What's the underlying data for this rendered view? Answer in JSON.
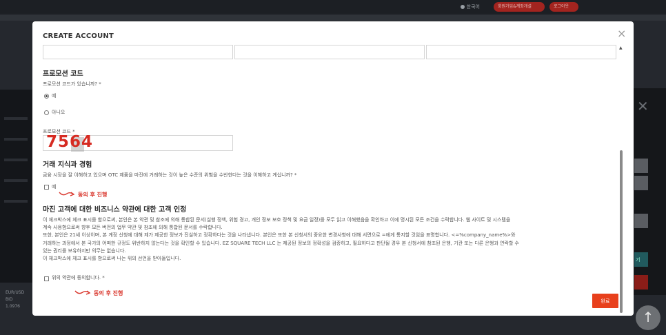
{
  "background": {
    "language": "한국어",
    "signup_button": "회원가입&계좌개설",
    "login_button": "로그아웃",
    "ticker": {
      "pair": "EUR/USD",
      "label": "BID",
      "value": "1.0976"
    },
    "side_button_label": "기"
  },
  "modal": {
    "title": "CREATE ACCOUNT",
    "close_symbol": "×",
    "promo": {
      "heading": "프로모션 코드",
      "question": "프로모션 코드가 있습니까? *",
      "options": [
        {
          "label": "예",
          "selected": true
        },
        {
          "label": "아니오",
          "selected": false
        }
      ],
      "field_label": "프로모션 코드 *",
      "field_value": "7564"
    },
    "knowledge": {
      "heading": "거래 지식과 경험",
      "question": "금융 시장을 잘 이해하고 있으며 OTC 제품을 마진에 거래하는 것이 높은 수준의 위험을 수반한다는 것을 이해하고 계십니까? *",
      "checkbox_label": "예",
      "annotation": "동의 후 진행"
    },
    "terms": {
      "heading": "마진 고객에 대한 비즈니스 약관에 대한 고객 인정",
      "paragraph1_line1": "이 체크박스에 체크 표시를 함으로써, 본인은 본 약관 및 참조에 의해 통합된 문서(실행 정책, 위험 경고, 개인 정보 보호 정책 및 요금 일정)를 모두 읽고 이해했음을 확인하고 이에 명시된 모든 조건을 수락합니다. 웹 사이트 및 시스템을",
      "paragraph1_line2": "계속 사용함으로써 향후 모든 버전의 업무 약관 및 참조에 의해 통합된 문서를 수락합니다.",
      "paragraph2_line1": "또한, 본인은 21세 이상이며, 본 계정 신청에 대해 제가 제공한 정보가 진실하고 정확하다는 것을 나타냅니다. 본인은 또한 본 신청서의 중요한 변경사항에 대해 서면으로 =에게 통지할 것임을 표명합니다. <=%company_name%>와",
      "paragraph2_line2": "거래하는 과정에서 본 국가의 어떠한 규정도 위반하지 않는다는 것을 확인할 수 있습니다. EZ SQUARE TECH LLC 는 제공된 정보의 정확성을 검증하고, 필요하다고 판단될 경우 본 신청서에 참조된 은행, 기관 또는 다른 은행과 연락할 수",
      "paragraph2_line3": "있는 권리를 보유하지만 의무는 없습니다.",
      "paragraph3": "이 체크박스에 체크 표시를 함으로써 나는 위의 선언을 받아들입니다.",
      "checkbox_label": "위의 약관에 동의합니다. *",
      "annotation": "동의 후 진행"
    },
    "submit_label": "완료"
  },
  "colors": {
    "accent": "#e8401c",
    "annotation": "#d9362c",
    "brand_red": "#a3241f"
  }
}
